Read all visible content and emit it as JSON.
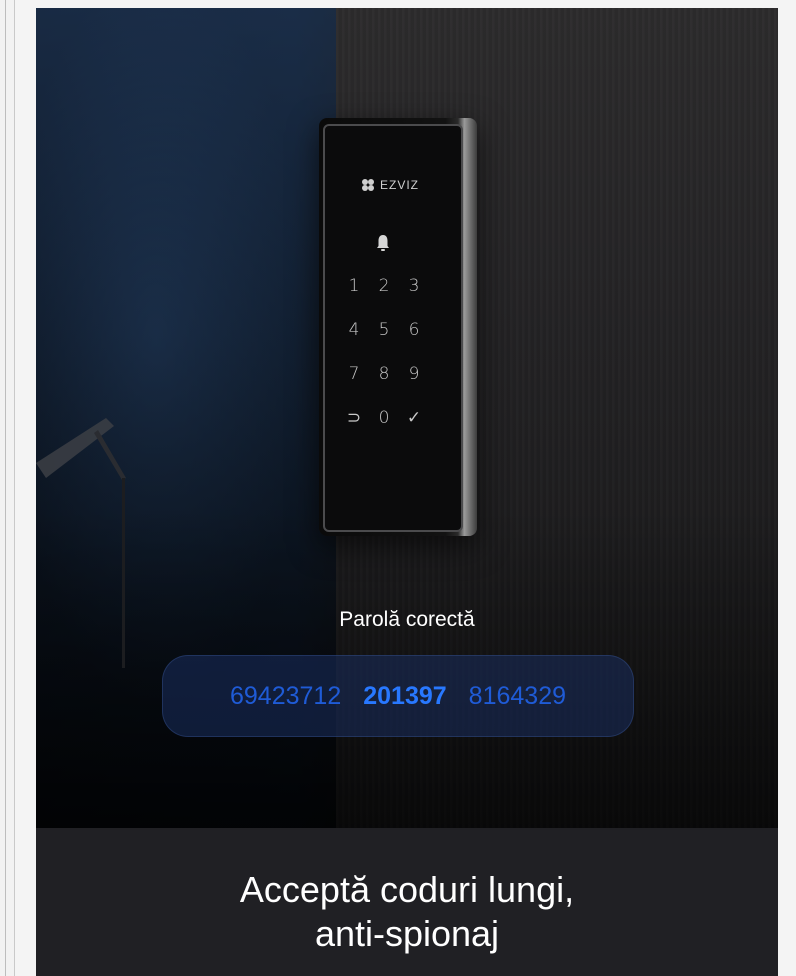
{
  "device": {
    "brand": "EZVIZ",
    "keys": [
      "1",
      "2",
      "3",
      "4",
      "5",
      "6",
      "7",
      "8",
      "9",
      "⊃",
      "0",
      "✓"
    ]
  },
  "status": {
    "label": "Parolă corectă"
  },
  "code": {
    "prefix": "69423712",
    "correct": "201397",
    "suffix": "8164329"
  },
  "caption": {
    "line1": "Acceptă coduri lungi,",
    "line2": "anti-spionaj"
  },
  "colors": {
    "accent": "#2878ff",
    "pill": "#1c2d5a",
    "caption_band": "#202024"
  },
  "icons": [
    "ezviz-logo-icon",
    "bell-icon"
  ]
}
